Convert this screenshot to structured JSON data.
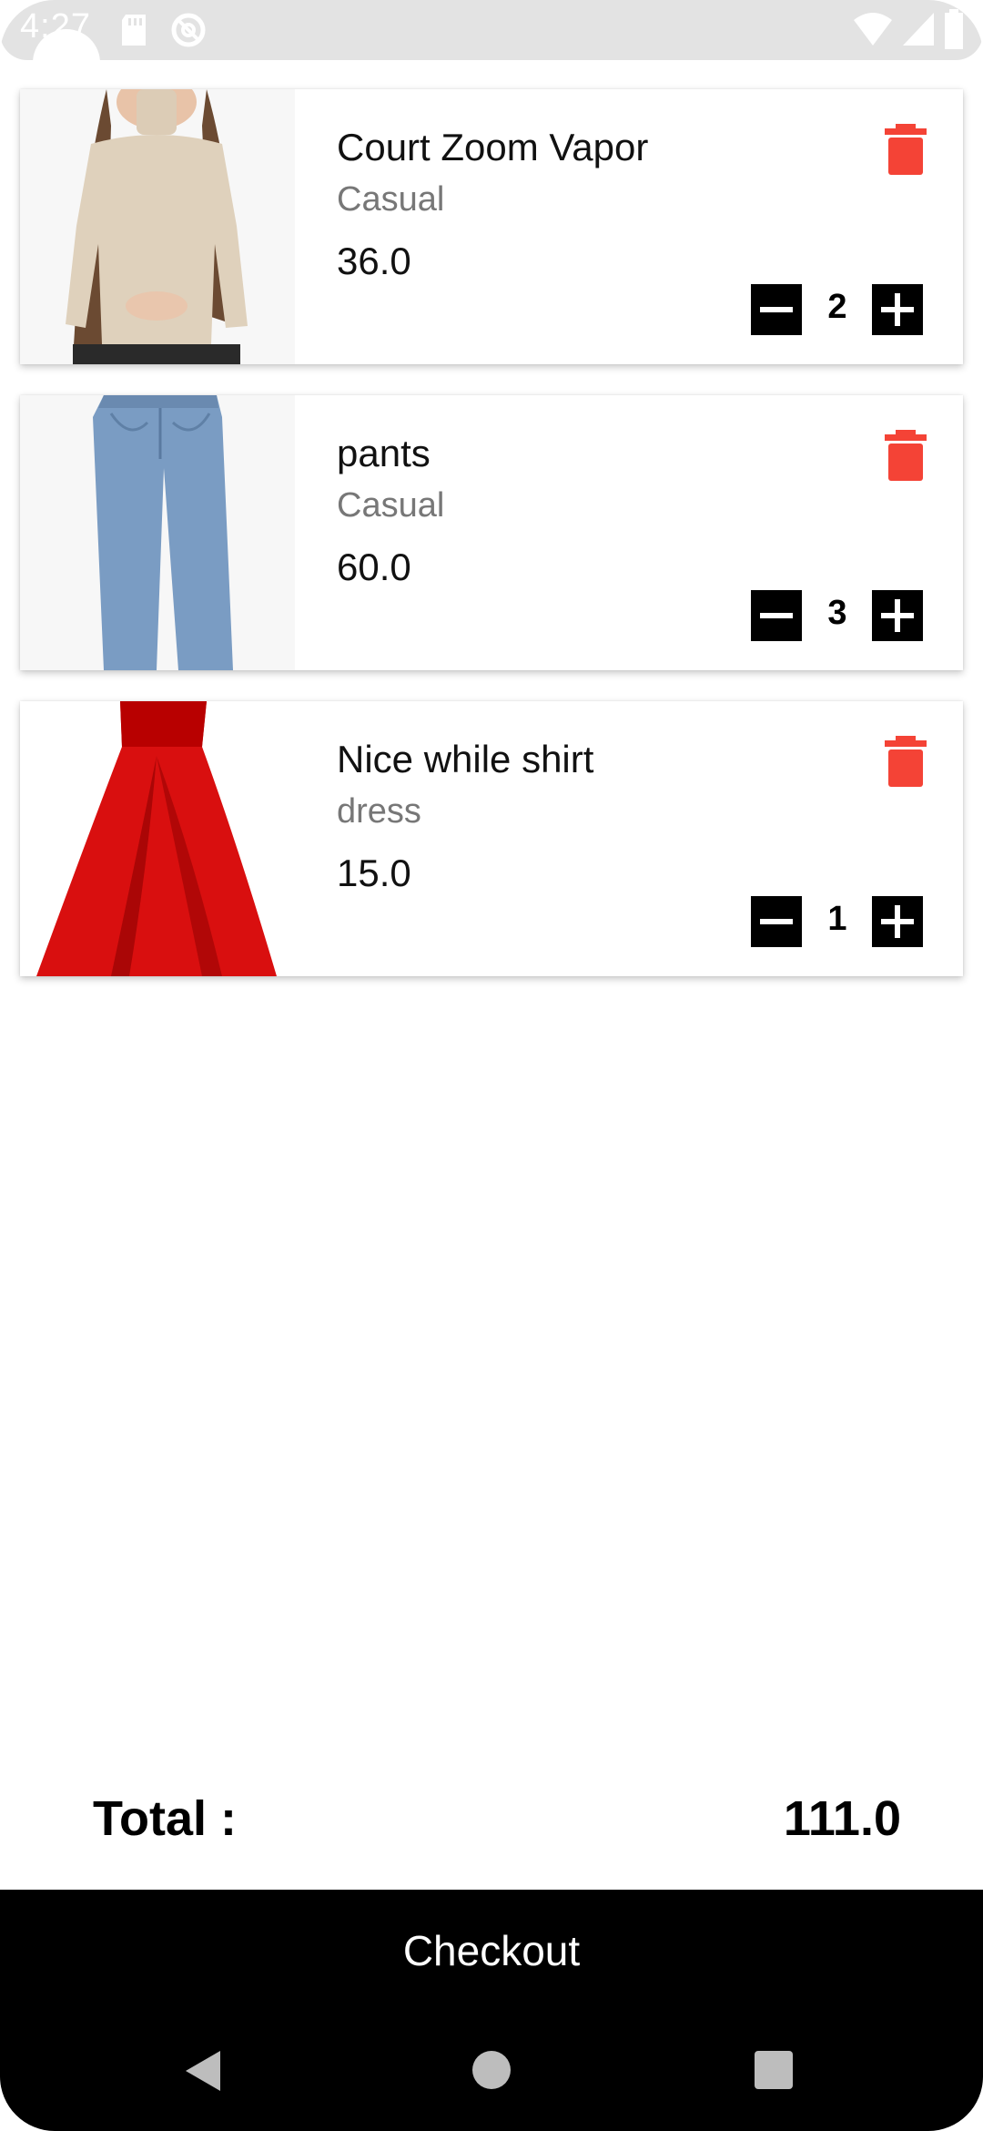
{
  "status_bar": {
    "time": "4:27",
    "icons": [
      "sd-card-icon",
      "do-not-disturb-icon",
      "wifi-icon",
      "signal-icon",
      "battery-icon"
    ]
  },
  "cart": {
    "items": [
      {
        "name": "Court Zoom Vapor",
        "category": "Casual",
        "price": "36.0",
        "quantity": "2",
        "image": "beige-turtleneck-sweater"
      },
      {
        "name": "pants",
        "category": "Casual",
        "price": "60.0",
        "quantity": "3",
        "image": "blue-jeans"
      },
      {
        "name": "Nice while shirt",
        "category": "dress",
        "price": "15.0",
        "quantity": "1",
        "image": "red-dress"
      }
    ]
  },
  "summary": {
    "total_label": "Total :",
    "total_value": "111.0"
  },
  "checkout": {
    "label": "Checkout"
  },
  "colors": {
    "delete": "#f44336",
    "checkout_bg": "#000000",
    "status_bar_bg": "#e3e3e3"
  },
  "nav": {
    "buttons": [
      "back-icon",
      "home-icon",
      "recents-icon"
    ]
  }
}
